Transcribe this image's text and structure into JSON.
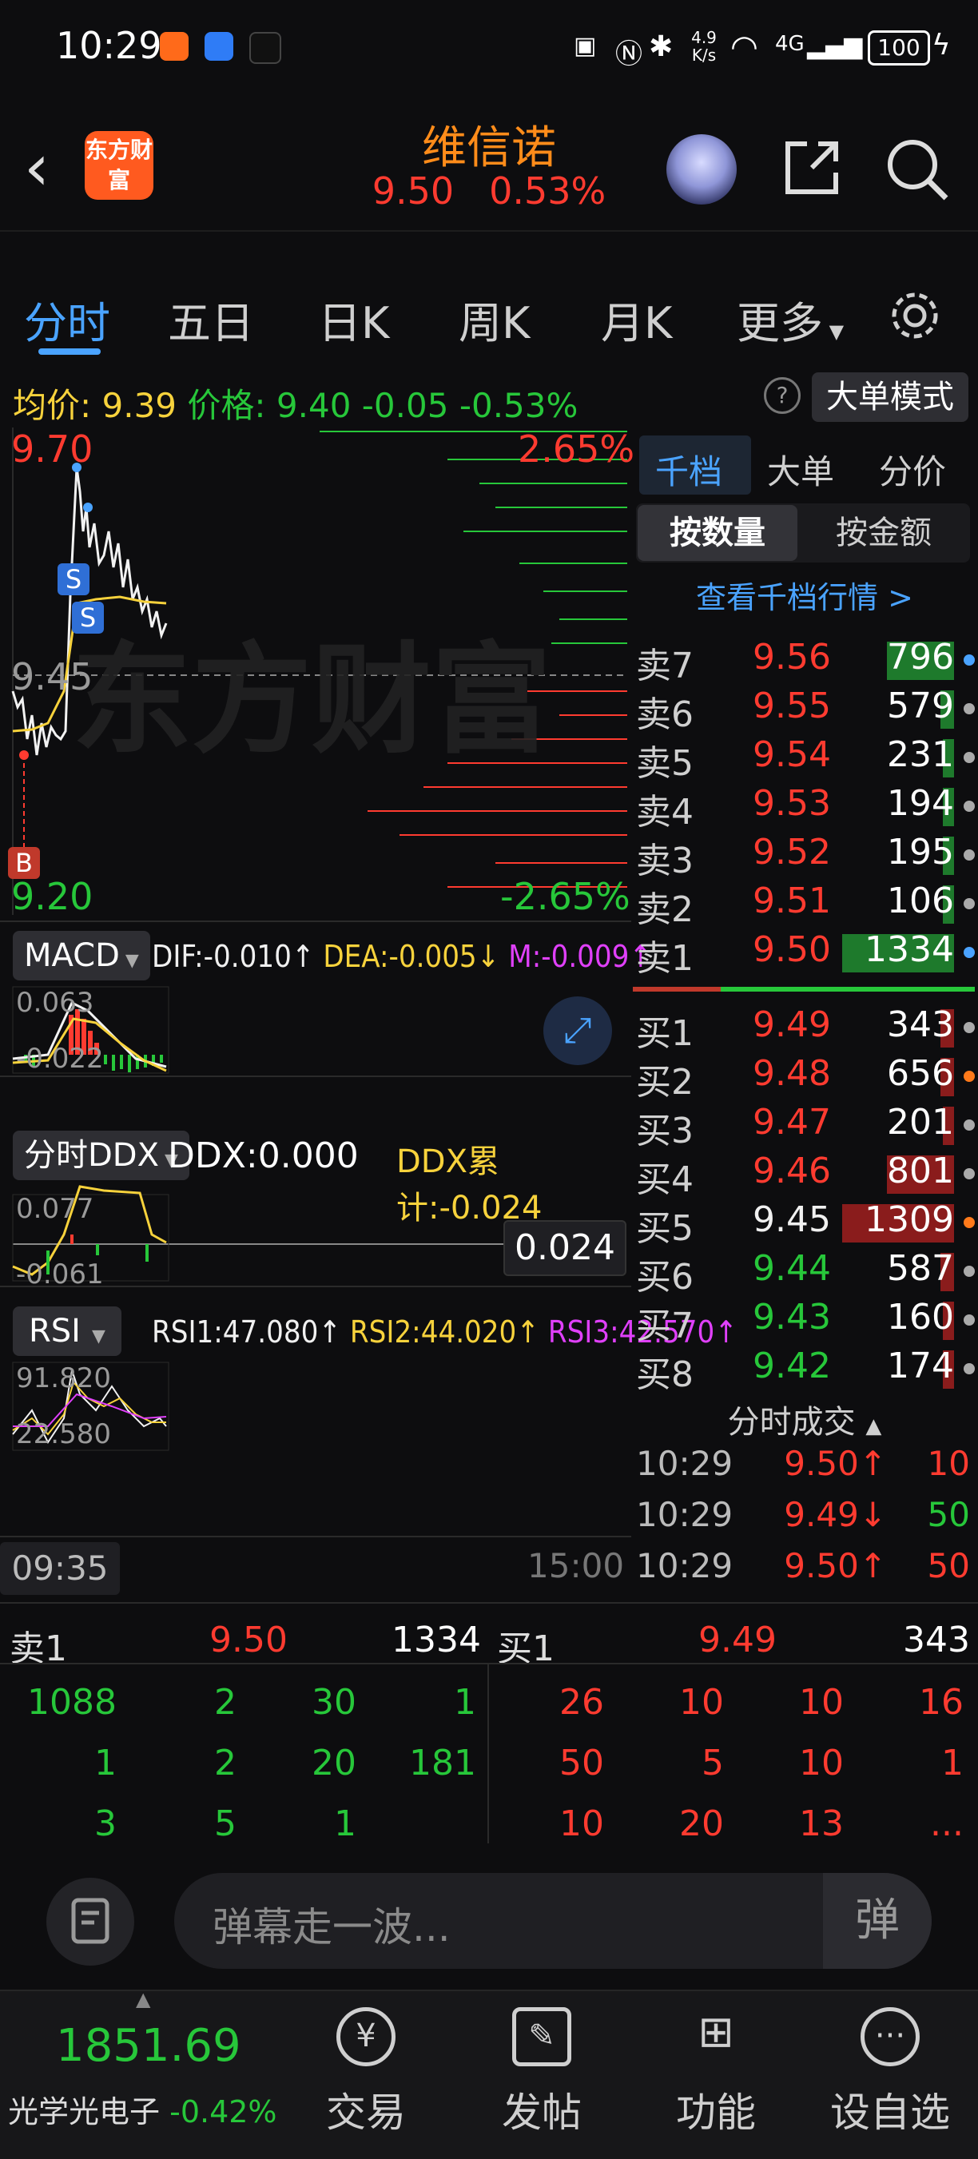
{
  "status": {
    "time": "10:29",
    "net_speed": "4.9 K/s",
    "battery": "100",
    "network": "4G"
  },
  "header": {
    "back_glyph": "‹",
    "logo_text": "东方财富",
    "stock_name": "维信诺",
    "price": "9.50",
    "change_pct": "0.53%"
  },
  "tabs": [
    {
      "label": "分时"
    },
    {
      "label": "五日"
    },
    {
      "label": "日K"
    },
    {
      "label": "周K"
    },
    {
      "label": "月K"
    },
    {
      "label": "更多"
    }
  ],
  "info": {
    "avg_label": "均价:",
    "avg": "9.39",
    "price_label": "价格:",
    "price": "9.40",
    "change": "-0.05",
    "change_pct": "-0.53%",
    "mode_button": "大单模式"
  },
  "chart": {
    "y_high": "9.70",
    "y_mid": "9.45",
    "y_low": "9.20",
    "pct_high": "2.65%",
    "pct_low": "-2.65%",
    "watermark": "东方财富",
    "marker_s": "S",
    "marker_b": "B",
    "time_start": "09:35",
    "time_end": "15:00",
    "macd": {
      "selector": "MACD",
      "dif": "DIF:-0.010↑",
      "dea": "DEA:-0.005↓",
      "m": "M:-0.009↑",
      "top": "0.063",
      "bottom": "-0.022"
    },
    "ddx": {
      "selector": "分时DDX",
      "ddx": "DDX:0.000",
      "cum": "DDX累计:-0.024",
      "top": "0.077",
      "bottom": "-0.061",
      "marker": "0.024"
    },
    "rsi": {
      "selector": "RSI",
      "r1": "RSI1:47.080↑",
      "r2": "RSI2:44.020↑",
      "r3": "RSI3:42.570↑",
      "top": "91.820",
      "bottom": "22.580"
    }
  },
  "book": {
    "tabs": [
      "千档",
      "大单",
      "分价"
    ],
    "toggle": [
      "按数量",
      "按金额"
    ],
    "link": "查看千档行情 >",
    "sells": [
      {
        "name": "卖7",
        "price": "9.56",
        "vol": "796",
        "fill": 0.6
      },
      {
        "name": "卖6",
        "price": "9.55",
        "vol": "579",
        "fill": 0.12
      },
      {
        "name": "卖5",
        "price": "9.54",
        "vol": "231",
        "fill": 0.08
      },
      {
        "name": "卖4",
        "price": "9.53",
        "vol": "194",
        "fill": 0.08
      },
      {
        "name": "卖3",
        "price": "9.52",
        "vol": "195",
        "fill": 0.08
      },
      {
        "name": "卖2",
        "price": "9.51",
        "vol": "106",
        "fill": 0.06
      },
      {
        "name": "卖1",
        "price": "9.50",
        "vol": "1334",
        "fill": 1.0
      }
    ],
    "buys": [
      {
        "name": "买1",
        "price": "9.49",
        "vol": "343",
        "fill": 0.12
      },
      {
        "name": "买2",
        "price": "9.48",
        "vol": "656",
        "fill": 0.12
      },
      {
        "name": "买3",
        "price": "9.47",
        "vol": "201",
        "fill": 0.08
      },
      {
        "name": "买4",
        "price": "9.46",
        "vol": "801",
        "fill": 0.6
      },
      {
        "name": "买5",
        "price": "9.45",
        "vol": "1309",
        "fill": 1.0
      },
      {
        "name": "买6",
        "price": "9.44",
        "vol": "587",
        "fill": 0.12
      },
      {
        "name": "买7",
        "price": "9.43",
        "vol": "160",
        "fill": 0.08
      },
      {
        "name": "买8",
        "price": "9.42",
        "vol": "174",
        "fill": 0.08
      }
    ],
    "trades_title": "分时成交",
    "trades": [
      {
        "time": "10:29",
        "price": "9.50↑",
        "vol": "10"
      },
      {
        "time": "10:29",
        "price": "9.49↓",
        "vol": "50"
      },
      {
        "time": "10:29",
        "price": "9.50↑",
        "vol": "50"
      }
    ]
  },
  "queue": {
    "sell_label": "卖1",
    "sell_price": "9.50",
    "sell_vol": "1334",
    "buy_label": "买1",
    "buy_price": "9.49",
    "buy_vol": "343",
    "sell_rows": [
      [
        "1088",
        "2",
        "30",
        "1"
      ],
      [
        "1",
        "2",
        "20",
        "181"
      ],
      [
        "3",
        "5",
        "1",
        ""
      ]
    ],
    "buy_rows": [
      [
        "26",
        "10",
        "10",
        "16"
      ],
      [
        "50",
        "5",
        "10",
        "1"
      ],
      [
        "10",
        "20",
        "13",
        "..."
      ]
    ]
  },
  "danmu": {
    "placeholder": "弹幕走一波...",
    "send": "弹"
  },
  "nav": {
    "index_value": "1851.69",
    "index_name": "光学光电子",
    "index_change": "-0.42%",
    "items": [
      {
        "label": "交易"
      },
      {
        "label": "发帖"
      },
      {
        "label": "功能"
      },
      {
        "label": "设自选"
      }
    ]
  },
  "colors": {
    "up": "#ff3b30",
    "down": "#27c73a",
    "accent": "#4aa3ff",
    "brand": "#ff5a1f"
  }
}
